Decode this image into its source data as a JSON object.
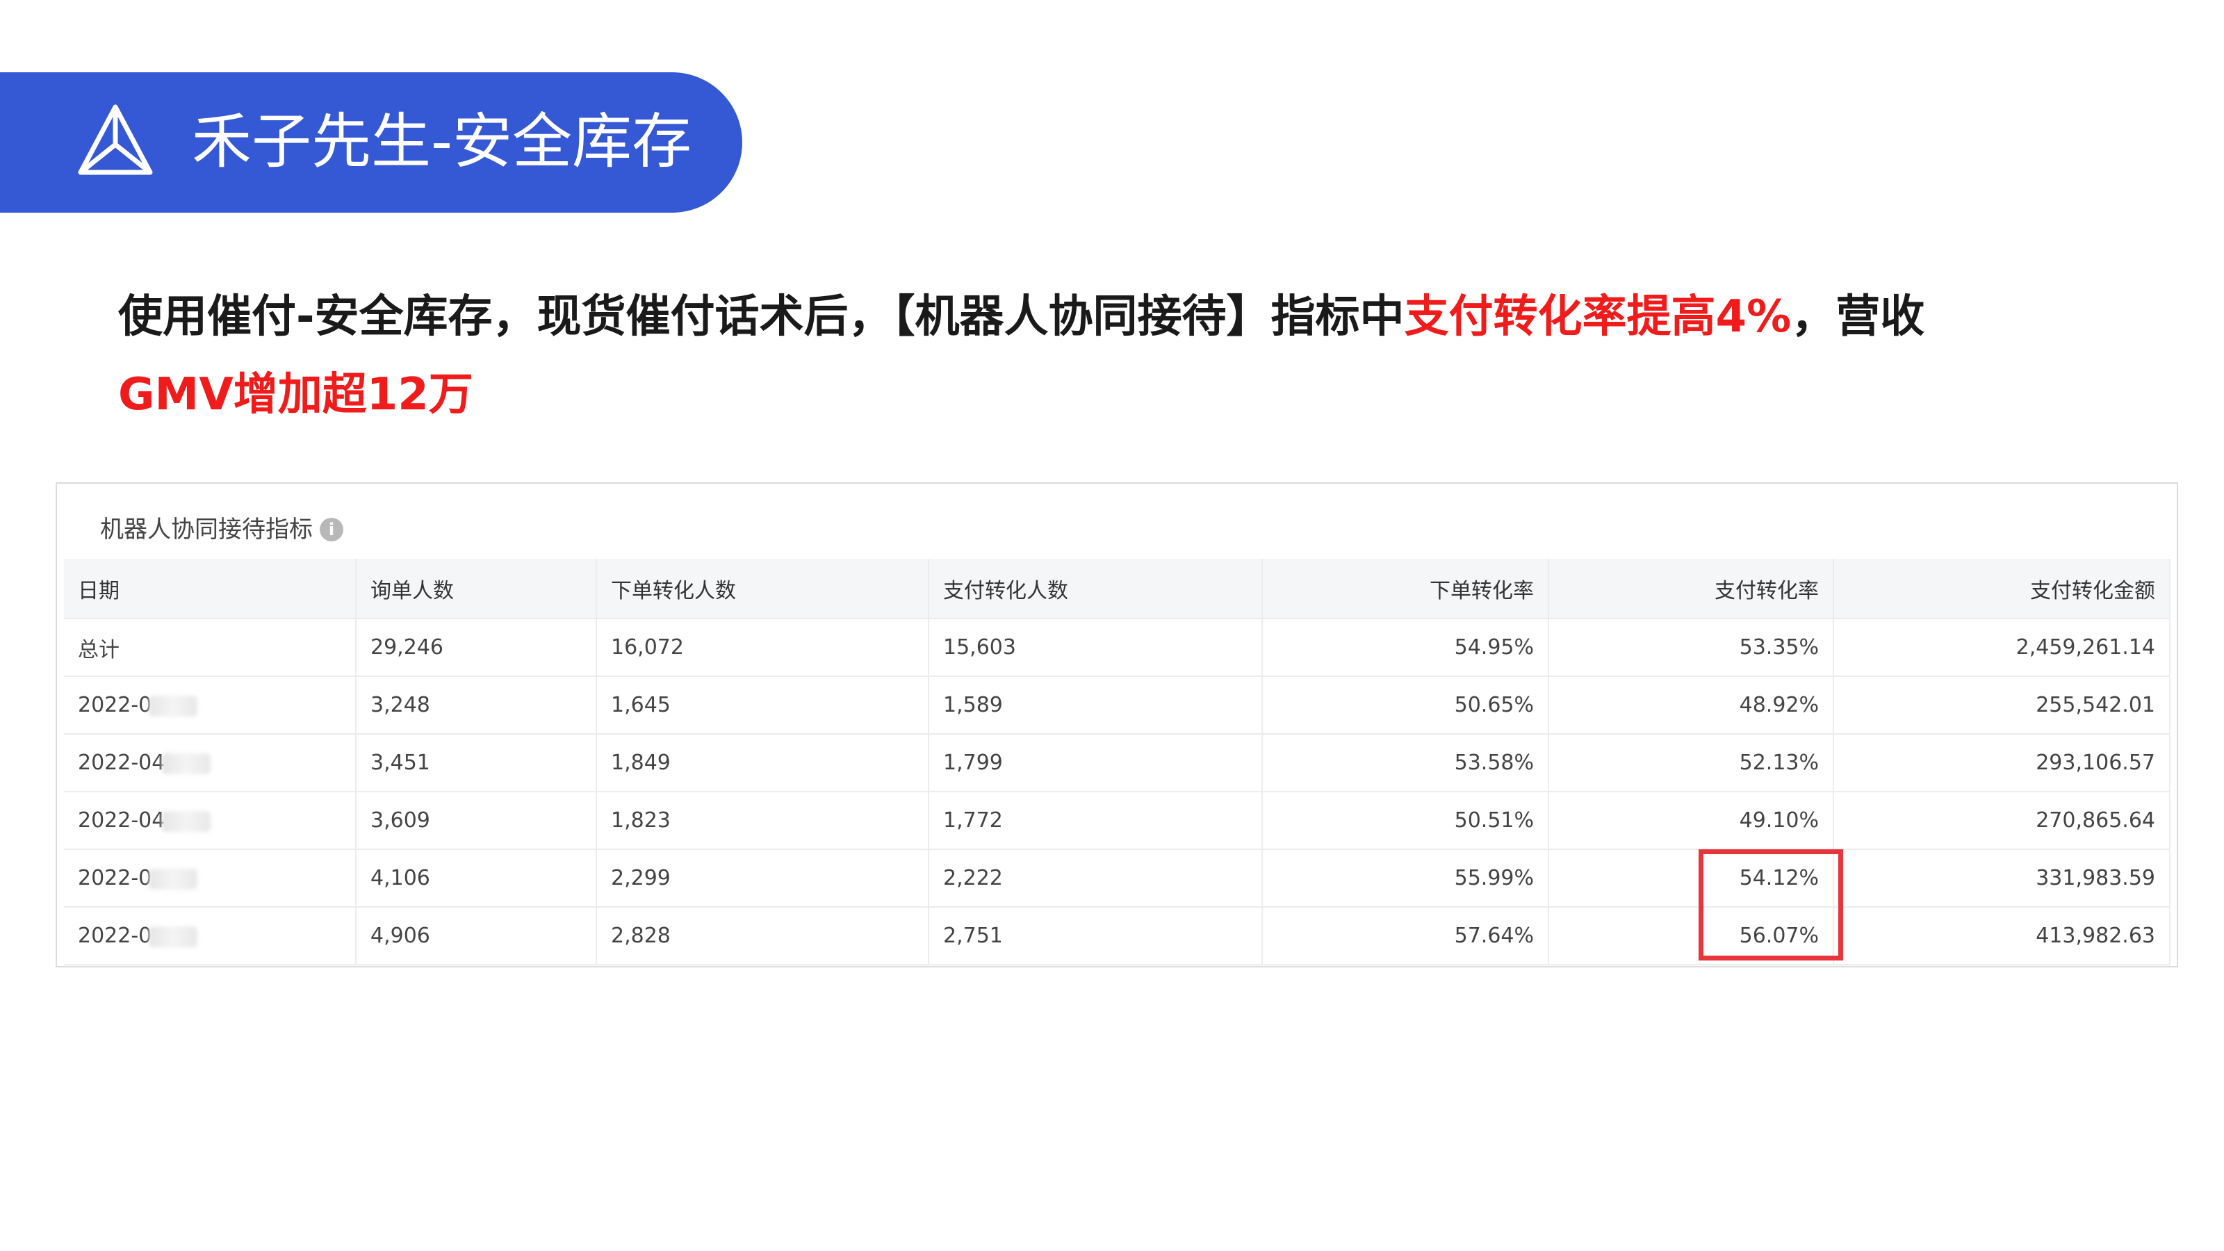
{
  "banner": {
    "title": "禾子先生-安全库存",
    "icon": "pyramid-logo-icon",
    "color": "#3558d4"
  },
  "headline": {
    "part1": "使用催付-安全库存，现货催付话术后，【机器人协同接待】指标中",
    "part2_red": "支付转化率提高4%",
    "part3": "，营收",
    "part4_red": "GMV增加超12万",
    "accent_color": "#f01b1b"
  },
  "panel": {
    "title": "机器人协同接待指标",
    "info_icon": "info-icon"
  },
  "table": {
    "columns": [
      "日期",
      "询单人数",
      "下单转化人数",
      "支付转化人数",
      "下单转化率",
      "支付转化率",
      "支付转化金额"
    ],
    "rows": [
      {
        "date": "总计",
        "inquiries": "29,246",
        "order_conv": "16,072",
        "pay_conv": "15,603",
        "order_rate": "54.95%",
        "pay_rate": "53.35%",
        "pay_amount": "2,459,261.14"
      },
      {
        "date": "2022-0",
        "inquiries": "3,248",
        "order_conv": "1,645",
        "pay_conv": "1,589",
        "order_rate": "50.65%",
        "pay_rate": "48.92%",
        "pay_amount": "255,542.01"
      },
      {
        "date": "2022-04",
        "inquiries": "3,451",
        "order_conv": "1,849",
        "pay_conv": "1,799",
        "order_rate": "53.58%",
        "pay_rate": "52.13%",
        "pay_amount": "293,106.57"
      },
      {
        "date": "2022-04",
        "inquiries": "3,609",
        "order_conv": "1,823",
        "pay_conv": "1,772",
        "order_rate": "50.51%",
        "pay_rate": "49.10%",
        "pay_amount": "270,865.64"
      },
      {
        "date": "2022-0",
        "inquiries": "4,106",
        "order_conv": "2,299",
        "pay_conv": "2,222",
        "order_rate": "55.99%",
        "pay_rate": "54.12%",
        "pay_amount": "331,983.59"
      },
      {
        "date": "2022-0",
        "inquiries": "4,906",
        "order_conv": "2,828",
        "pay_conv": "2,751",
        "order_rate": "57.64%",
        "pay_rate": "56.07%",
        "pay_amount": "413,982.63"
      }
    ],
    "highlight_color": "#e8353b"
  }
}
